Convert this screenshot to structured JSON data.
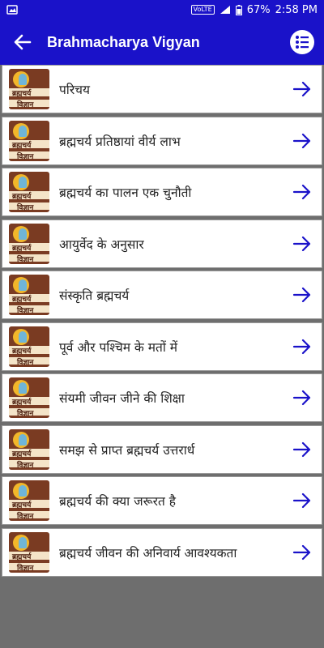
{
  "status_bar": {
    "volte": "VoLTE",
    "battery": "67%",
    "time": "2:58 PM"
  },
  "app_bar": {
    "title": "Brahmacharya Vigyan",
    "color": "#1a12c9"
  },
  "thumbnail": {
    "line1": "ब्रह्मचर्य",
    "line2": "विज्ञान"
  },
  "items": [
    {
      "label": "परिचय"
    },
    {
      "label": "ब्रह्मचर्य प्रतिष्ठायां वीर्य लाभ"
    },
    {
      "label": "ब्रह्मचर्य का पालन एक चुनौती"
    },
    {
      "label": "आयुर्वेद के अनुसार"
    },
    {
      "label": "संस्कृति ब्रह्मचर्य"
    },
    {
      "label": "पूर्व और पश्चिम के मतों में"
    },
    {
      "label": "संयमी जीवन जीने की शिक्षा"
    },
    {
      "label": "समझ से प्राप्त ब्रह्मचर्य उत्तरार्ध"
    },
    {
      "label": "ब्रह्मचर्य की क्या जरूरत है"
    },
    {
      "label": "ब्रह्मचर्य जीवन की अनिवार्य आवश्यकता"
    }
  ]
}
